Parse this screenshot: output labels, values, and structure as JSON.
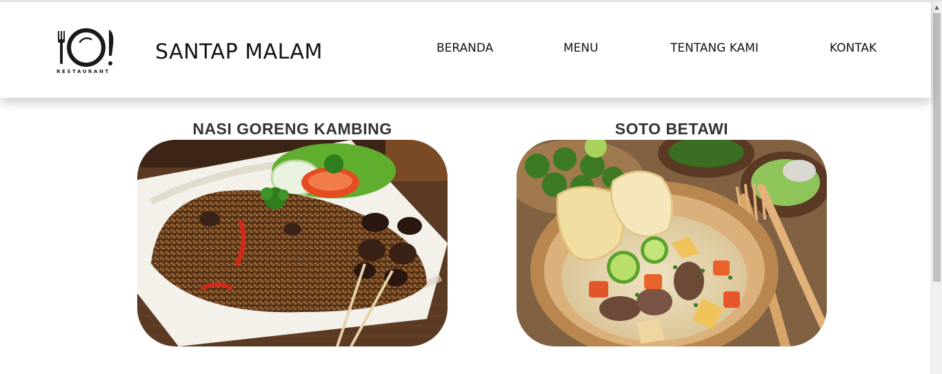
{
  "header": {
    "logo_text": "RESTAURANT",
    "site_title": "SANTAP MALAM",
    "nav": [
      {
        "label": "BERANDA"
      },
      {
        "label": "MENU"
      },
      {
        "label": "TENTANG KAMI"
      },
      {
        "label": "KONTAK"
      }
    ]
  },
  "menu": {
    "items": [
      {
        "title": "NASI GORENG KAMBING",
        "image": "nasi-goreng-kambing-photo"
      },
      {
        "title": "SOTO BETAWI",
        "image": "soto-betawi-photo"
      }
    ]
  },
  "colors": {
    "header_bg": "#ffffff",
    "text": "#111111",
    "title_text": "#333333"
  }
}
